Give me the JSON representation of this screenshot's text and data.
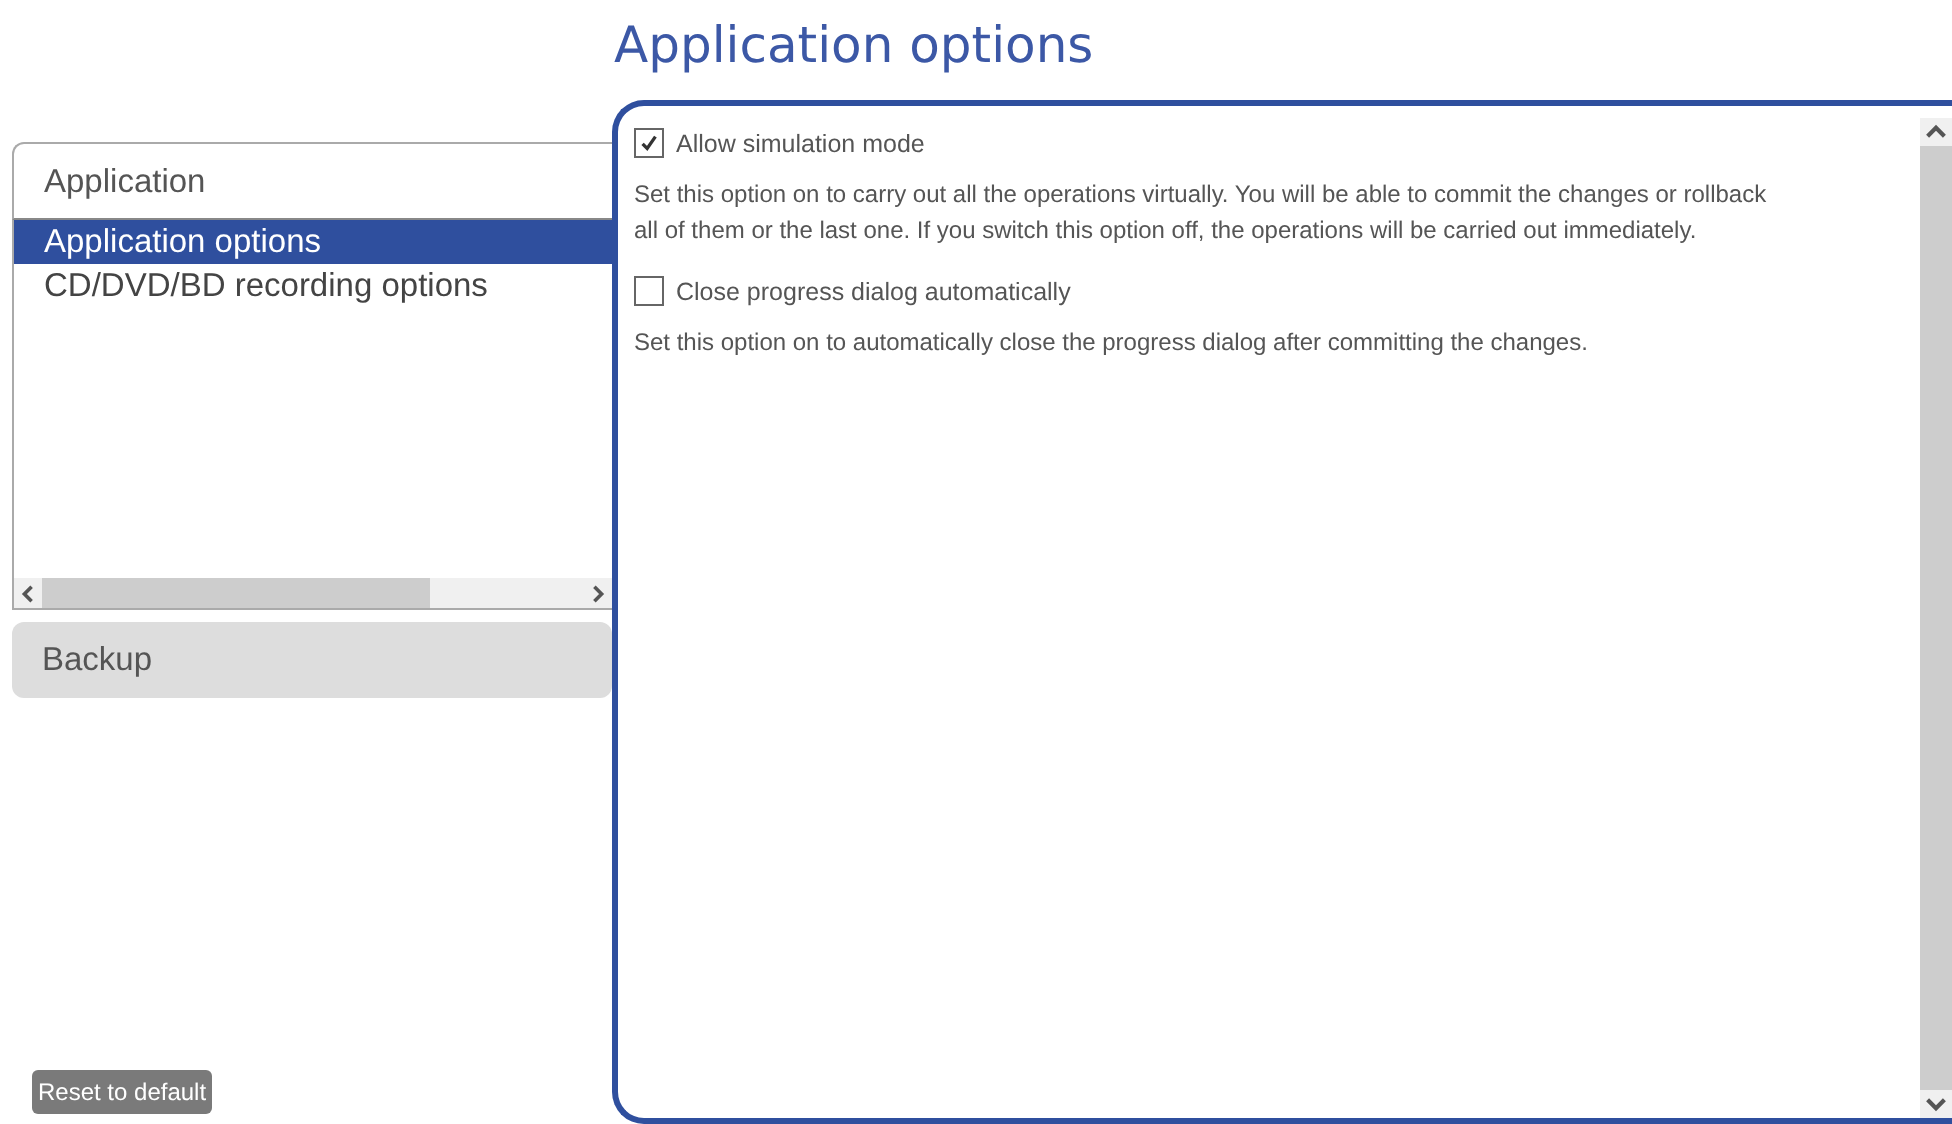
{
  "page_title": "Application options",
  "sidebar": {
    "groups": [
      {
        "label": "Application",
        "expanded": true,
        "items": [
          {
            "label": "Application options",
            "selected": true
          },
          {
            "label": "CD/DVD/BD recording options",
            "selected": false
          }
        ]
      },
      {
        "label": "Backup",
        "expanded": false
      }
    ]
  },
  "reset_button": "Reset to default",
  "options": [
    {
      "label": "Allow simulation mode",
      "checked": true,
      "description": "Set this option on to carry out all the operations virtually. You will be able to commit the changes or rollback all of them or the last one. If you switch this option off, the operations will be carried out immediately."
    },
    {
      "label": "Close progress dialog automatically",
      "checked": false,
      "description": "Set this option on to automatically close the progress dialog after committing the changes."
    }
  ]
}
